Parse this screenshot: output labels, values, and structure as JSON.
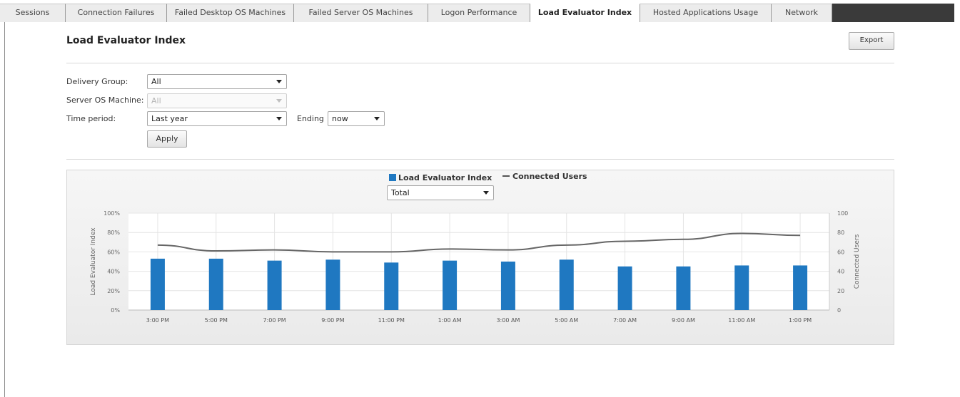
{
  "tabs": [
    {
      "label": "Sessions",
      "active": false
    },
    {
      "label": "Connection Failures",
      "active": false
    },
    {
      "label": "Failed Desktop OS Machines",
      "active": false
    },
    {
      "label": "Failed Server OS Machines",
      "active": false
    },
    {
      "label": "Logon Performance",
      "active": false
    },
    {
      "label": "Load Evaluator Index",
      "active": true
    },
    {
      "label": "Hosted Applications Usage",
      "active": false
    },
    {
      "label": "Network",
      "active": false
    }
  ],
  "page": {
    "title": "Load Evaluator Index",
    "export_label": "Export"
  },
  "filters": {
    "delivery_group_label": "Delivery Group:",
    "delivery_group_value": "All",
    "server_os_label": "Server OS Machine:",
    "server_os_value": "All",
    "time_period_label": "Time period:",
    "time_period_value": "Last year",
    "ending_label": "Ending",
    "ending_value": "now",
    "apply_label": "Apply"
  },
  "chart_controls": {
    "view_value": "Total"
  },
  "chart_data": {
    "type": "bar",
    "categories": [
      "3:00 PM",
      "5:00 PM",
      "7:00 PM",
      "9:00 PM",
      "11:00 PM",
      "1:00 AM",
      "3:00 AM",
      "5:00 AM",
      "7:00 AM",
      "9:00 AM",
      "11:00 AM",
      "1:00 PM"
    ],
    "series": [
      {
        "name": "Load Evaluator Index",
        "type": "bar",
        "axis": "left",
        "color": "#1f78c1",
        "values": [
          53,
          53,
          51,
          52,
          49,
          51,
          50,
          52,
          45,
          45,
          46,
          46
        ]
      },
      {
        "name": "Connected Users",
        "type": "line",
        "axis": "right",
        "color": "#666666",
        "values": [
          67,
          61,
          62,
          60,
          60,
          63,
          62,
          67,
          71,
          73,
          79,
          77
        ]
      }
    ],
    "ylabel": "Load Evaluator Index",
    "ylabel_right": "Connected Users",
    "ylim": [
      0,
      100
    ],
    "ylim_right": [
      0,
      100
    ],
    "yticks": [
      "0%",
      "20%",
      "40%",
      "60%",
      "80%",
      "100%"
    ],
    "yticks_right": [
      "0",
      "20",
      "40",
      "60",
      "80",
      "100"
    ],
    "grid": true,
    "legend": "top-center"
  }
}
